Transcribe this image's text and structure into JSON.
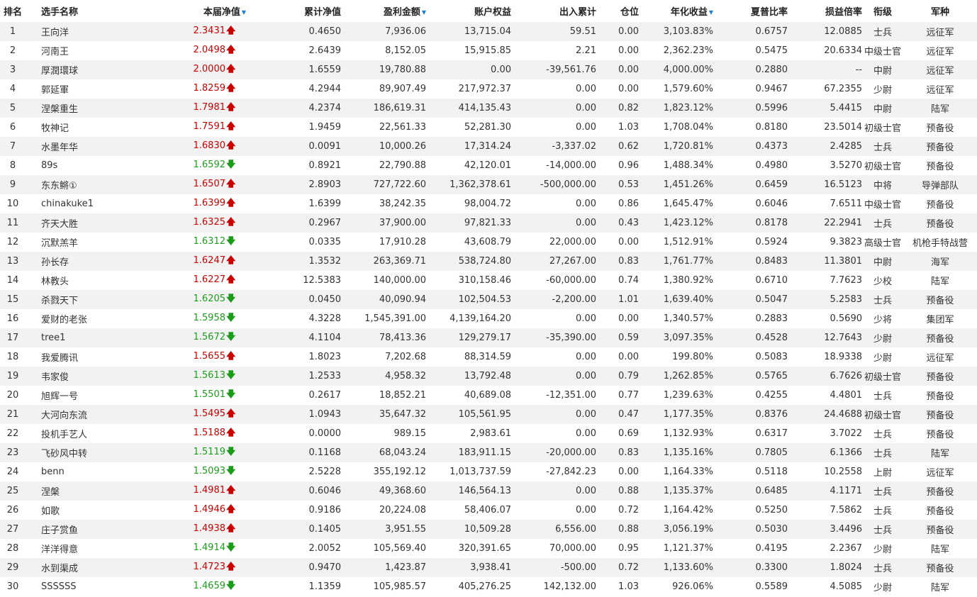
{
  "headers": {
    "rank": "排名",
    "name": "选手名称",
    "nav": "本届净值",
    "cum_nav": "累计净值",
    "profit": "盈利金额",
    "equity": "账户权益",
    "flow": "出入累计",
    "position": "仓位",
    "annual": "年化收益",
    "sharpe": "夏普比率",
    "plr": "损益倍率",
    "rank_title": "衔级",
    "branch": "军种"
  },
  "sort_marker": "▼",
  "arrows": {
    "up": "🡅",
    "down": "🡇"
  },
  "colors": {
    "up": "#cc0000",
    "down": "#1a9e1a",
    "sort": "#1e7fd1",
    "row_alt": "#f2f2f2"
  },
  "rows": [
    {
      "rank": "1",
      "name": "王向洋",
      "nav": "2.3431",
      "dir": "up",
      "cum_nav": "0.4650",
      "profit": "7,936.06",
      "equity": "13,715.04",
      "flow": "59.51",
      "position": "0.00",
      "annual": "3,103.83%",
      "sharpe": "0.6757",
      "plr": "12.0885",
      "rank_title": "士兵",
      "branch": "远征军"
    },
    {
      "rank": "2",
      "name": "河南王",
      "nav": "2.0498",
      "dir": "up",
      "cum_nav": "2.6439",
      "profit": "8,152.05",
      "equity": "15,915.85",
      "flow": "2.21",
      "position": "0.00",
      "annual": "2,362.23%",
      "sharpe": "0.5475",
      "plr": "20.6334",
      "rank_title": "中级士官",
      "branch": "远征军"
    },
    {
      "rank": "3",
      "name": "厚潤環球",
      "nav": "2.0000",
      "dir": "up",
      "cum_nav": "1.6559",
      "profit": "19,780.88",
      "equity": "0.00",
      "flow": "-39,561.76",
      "position": "0.00",
      "annual": "4,000.00%",
      "sharpe": "0.2880",
      "plr": "--",
      "rank_title": "中尉",
      "branch": "远征军"
    },
    {
      "rank": "4",
      "name": "郭延軍",
      "nav": "1.8259",
      "dir": "up",
      "cum_nav": "4.2944",
      "profit": "89,907.49",
      "equity": "217,972.37",
      "flow": "0.00",
      "position": "0.00",
      "annual": "1,579.60%",
      "sharpe": "0.9467",
      "plr": "67.2355",
      "rank_title": "少尉",
      "branch": "远征军"
    },
    {
      "rank": "5",
      "name": "涅槃重生",
      "nav": "1.7981",
      "dir": "up",
      "cum_nav": "4.2374",
      "profit": "186,619.31",
      "equity": "414,135.43",
      "flow": "0.00",
      "position": "0.82",
      "annual": "1,823.12%",
      "sharpe": "0.5996",
      "plr": "5.4415",
      "rank_title": "中尉",
      "branch": "陆军"
    },
    {
      "rank": "6",
      "name": "牧神记",
      "nav": "1.7591",
      "dir": "up",
      "cum_nav": "1.9459",
      "profit": "22,561.33",
      "equity": "52,281.30",
      "flow": "0.00",
      "position": "1.03",
      "annual": "1,708.04%",
      "sharpe": "0.8180",
      "plr": "23.5014",
      "rank_title": "初级士官",
      "branch": "预备役"
    },
    {
      "rank": "7",
      "name": "水墨年华",
      "nav": "1.6830",
      "dir": "up",
      "cum_nav": "0.0091",
      "profit": "10,000.26",
      "equity": "17,314.24",
      "flow": "-3,337.02",
      "position": "0.62",
      "annual": "1,720.81%",
      "sharpe": "0.4373",
      "plr": "2.4285",
      "rank_title": "士兵",
      "branch": "预备役"
    },
    {
      "rank": "8",
      "name": "89s",
      "nav": "1.6592",
      "dir": "down",
      "cum_nav": "0.8921",
      "profit": "22,790.88",
      "equity": "42,120.01",
      "flow": "-14,000.00",
      "position": "0.96",
      "annual": "1,488.34%",
      "sharpe": "0.4980",
      "plr": "3.5270",
      "rank_title": "初级士官",
      "branch": "预备役"
    },
    {
      "rank": "9",
      "name": "东东鳉①",
      "nav": "1.6507",
      "dir": "up",
      "cum_nav": "2.8903",
      "profit": "727,722.60",
      "equity": "1,362,378.61",
      "flow": "-500,000.00",
      "position": "0.53",
      "annual": "1,451.26%",
      "sharpe": "0.6459",
      "plr": "16.5123",
      "rank_title": "中将",
      "branch": "导弹部队"
    },
    {
      "rank": "10",
      "name": "chinakuke1",
      "nav": "1.6399",
      "dir": "up",
      "cum_nav": "1.6399",
      "profit": "38,242.35",
      "equity": "98,004.72",
      "flow": "0.00",
      "position": "0.86",
      "annual": "1,645.47%",
      "sharpe": "0.6046",
      "plr": "7.6511",
      "rank_title": "中级士官",
      "branch": "预备役"
    },
    {
      "rank": "11",
      "name": "齐天大胜",
      "nav": "1.6325",
      "dir": "up",
      "cum_nav": "0.2967",
      "profit": "37,900.00",
      "equity": "97,821.33",
      "flow": "0.00",
      "position": "0.43",
      "annual": "1,423.12%",
      "sharpe": "0.8178",
      "plr": "22.2941",
      "rank_title": "士兵",
      "branch": "预备役"
    },
    {
      "rank": "12",
      "name": "沉默羔羊",
      "nav": "1.6312",
      "dir": "down",
      "cum_nav": "0.0335",
      "profit": "17,910.28",
      "equity": "43,608.79",
      "flow": "22,000.00",
      "position": "0.00",
      "annual": "1,512.91%",
      "sharpe": "0.5924",
      "plr": "9.3823",
      "rank_title": "高级士官",
      "branch": "机枪手特战营"
    },
    {
      "rank": "13",
      "name": "孙长存",
      "nav": "1.6247",
      "dir": "up",
      "cum_nav": "1.3532",
      "profit": "263,369.71",
      "equity": "538,724.80",
      "flow": "27,267.00",
      "position": "0.83",
      "annual": "1,761.77%",
      "sharpe": "0.8483",
      "plr": "11.3801",
      "rank_title": "中尉",
      "branch": "海军"
    },
    {
      "rank": "14",
      "name": "林教头",
      "nav": "1.6227",
      "dir": "up",
      "cum_nav": "12.5383",
      "profit": "140,000.00",
      "equity": "310,158.46",
      "flow": "-60,000.00",
      "position": "0.74",
      "annual": "1,380.92%",
      "sharpe": "0.6710",
      "plr": "7.7623",
      "rank_title": "少校",
      "branch": "陆军"
    },
    {
      "rank": "15",
      "name": "杀戮天下",
      "nav": "1.6205",
      "dir": "down",
      "cum_nav": "0.0450",
      "profit": "40,090.94",
      "equity": "102,504.53",
      "flow": "-2,200.00",
      "position": "1.01",
      "annual": "1,639.40%",
      "sharpe": "0.5047",
      "plr": "5.2583",
      "rank_title": "士兵",
      "branch": "预备役"
    },
    {
      "rank": "16",
      "name": "爱财的老张",
      "nav": "1.5958",
      "dir": "down",
      "cum_nav": "4.3228",
      "profit": "1,545,391.00",
      "equity": "4,139,164.20",
      "flow": "0.00",
      "position": "0.00",
      "annual": "1,340.57%",
      "sharpe": "0.2883",
      "plr": "0.5690",
      "rank_title": "少将",
      "branch": "集团军"
    },
    {
      "rank": "17",
      "name": "tree1",
      "nav": "1.5672",
      "dir": "down",
      "cum_nav": "4.1104",
      "profit": "78,413.36",
      "equity": "129,279.17",
      "flow": "-35,390.00",
      "position": "0.59",
      "annual": "3,097.35%",
      "sharpe": "0.4528",
      "plr": "12.7643",
      "rank_title": "少尉",
      "branch": "预备役"
    },
    {
      "rank": "18",
      "name": "我爱腾讯",
      "nav": "1.5655",
      "dir": "up",
      "cum_nav": "1.8023",
      "profit": "7,202.68",
      "equity": "88,314.59",
      "flow": "0.00",
      "position": "0.00",
      "annual": "199.80%",
      "sharpe": "0.5083",
      "plr": "18.9338",
      "rank_title": "少尉",
      "branch": "远征军"
    },
    {
      "rank": "19",
      "name": "韦家俊",
      "nav": "1.5613",
      "dir": "down",
      "cum_nav": "1.2533",
      "profit": "4,958.32",
      "equity": "13,792.48",
      "flow": "0.00",
      "position": "0.79",
      "annual": "1,262.85%",
      "sharpe": "0.5765",
      "plr": "6.7626",
      "rank_title": "初级士官",
      "branch": "预备役"
    },
    {
      "rank": "20",
      "name": "旭辉一号",
      "nav": "1.5501",
      "dir": "down",
      "cum_nav": "0.2617",
      "profit": "18,852.21",
      "equity": "40,689.08",
      "flow": "-12,351.00",
      "position": "0.77",
      "annual": "1,239.63%",
      "sharpe": "0.4255",
      "plr": "4.4801",
      "rank_title": "士兵",
      "branch": "预备役"
    },
    {
      "rank": "21",
      "name": "大河向东流",
      "nav": "1.5495",
      "dir": "up",
      "cum_nav": "1.0943",
      "profit": "35,647.32",
      "equity": "105,561.95",
      "flow": "0.00",
      "position": "0.47",
      "annual": "1,177.35%",
      "sharpe": "0.8376",
      "plr": "24.4688",
      "rank_title": "初级士官",
      "branch": "预备役"
    },
    {
      "rank": "22",
      "name": "投机手艺人",
      "nav": "1.5188",
      "dir": "up",
      "cum_nav": "0.0000",
      "profit": "989.15",
      "equity": "2,983.61",
      "flow": "0.00",
      "position": "0.69",
      "annual": "1,132.93%",
      "sharpe": "0.6317",
      "plr": "3.7022",
      "rank_title": "士兵",
      "branch": "预备役"
    },
    {
      "rank": "23",
      "name": "飞砂风中转",
      "nav": "1.5119",
      "dir": "down",
      "cum_nav": "0.1168",
      "profit": "68,043.24",
      "equity": "183,911.15",
      "flow": "-20,000.00",
      "position": "0.83",
      "annual": "1,135.16%",
      "sharpe": "0.7805",
      "plr": "6.1366",
      "rank_title": "士兵",
      "branch": "陆军"
    },
    {
      "rank": "24",
      "name": "benn",
      "nav": "1.5093",
      "dir": "down",
      "cum_nav": "2.5228",
      "profit": "355,192.12",
      "equity": "1,013,737.59",
      "flow": "-27,842.23",
      "position": "0.00",
      "annual": "1,164.33%",
      "sharpe": "0.5118",
      "plr": "10.2558",
      "rank_title": "上尉",
      "branch": "远征军"
    },
    {
      "rank": "25",
      "name": "涅槃",
      "nav": "1.4981",
      "dir": "up",
      "cum_nav": "0.6046",
      "profit": "49,368.60",
      "equity": "146,564.13",
      "flow": "0.00",
      "position": "0.88",
      "annual": "1,135.37%",
      "sharpe": "0.6485",
      "plr": "4.1171",
      "rank_title": "士兵",
      "branch": "预备役"
    },
    {
      "rank": "26",
      "name": "如歌",
      "nav": "1.4946",
      "dir": "up",
      "cum_nav": "0.9186",
      "profit": "20,224.08",
      "equity": "58,406.07",
      "flow": "0.00",
      "position": "0.72",
      "annual": "1,164.42%",
      "sharpe": "0.5250",
      "plr": "7.5862",
      "rank_title": "士兵",
      "branch": "预备役"
    },
    {
      "rank": "27",
      "name": "庄子赏鱼",
      "nav": "1.4938",
      "dir": "up",
      "cum_nav": "0.1405",
      "profit": "3,951.55",
      "equity": "10,509.28",
      "flow": "6,556.00",
      "position": "0.88",
      "annual": "3,056.19%",
      "sharpe": "0.5030",
      "plr": "3.4496",
      "rank_title": "士兵",
      "branch": "预备役"
    },
    {
      "rank": "28",
      "name": "洋洋得意",
      "nav": "1.4914",
      "dir": "down",
      "cum_nav": "2.0052",
      "profit": "105,569.40",
      "equity": "320,391.65",
      "flow": "70,000.00",
      "position": "0.95",
      "annual": "1,121.37%",
      "sharpe": "0.4195",
      "plr": "2.2367",
      "rank_title": "少尉",
      "branch": "陆军"
    },
    {
      "rank": "29",
      "name": "水到渠成",
      "nav": "1.4723",
      "dir": "up",
      "cum_nav": "0.9470",
      "profit": "1,423.87",
      "equity": "3,938.41",
      "flow": "-500.00",
      "position": "0.72",
      "annual": "1,133.60%",
      "sharpe": "0.3300",
      "plr": "1.8024",
      "rank_title": "士兵",
      "branch": "预备役"
    },
    {
      "rank": "30",
      "name": "SSSSSS",
      "nav": "1.4659",
      "dir": "down",
      "cum_nav": "1.1359",
      "profit": "105,985.57",
      "equity": "405,276.25",
      "flow": "142,132.00",
      "position": "1.03",
      "annual": "926.06%",
      "sharpe": "0.5589",
      "plr": "4.5085",
      "rank_title": "少尉",
      "branch": "陆军"
    }
  ]
}
